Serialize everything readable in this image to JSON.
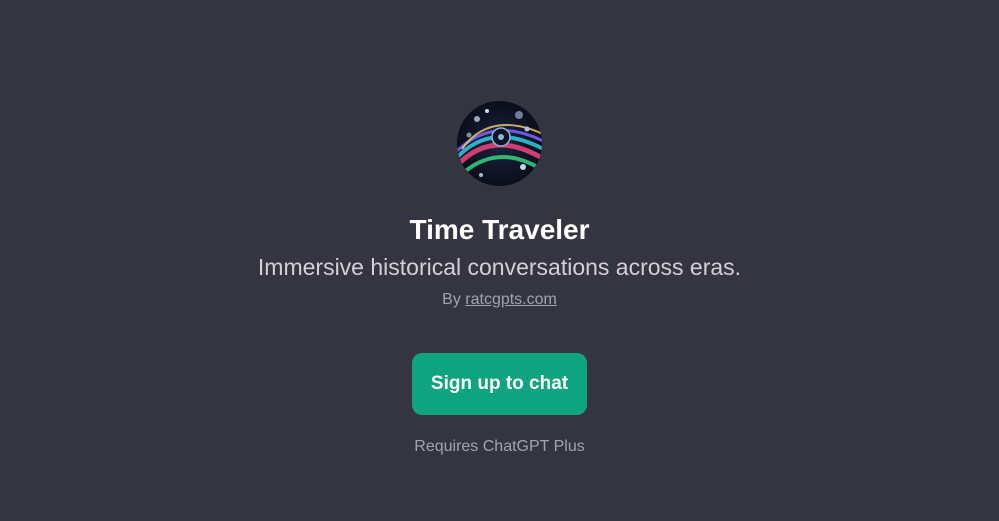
{
  "gpt": {
    "title": "Time Traveler",
    "description": "Immersive historical conversations across eras.",
    "byline_prefix": "By",
    "author": "ratcgpts.com",
    "avatar_icon": "swirling-time-vortex-avatar"
  },
  "cta": {
    "label": "Sign up to chat"
  },
  "requirement": "Requires ChatGPT Plus",
  "colors": {
    "background": "#343541",
    "accent": "#10a37f",
    "title": "#ffffff",
    "subtitle": "#d1d1d6",
    "muted": "#a3a3ad"
  }
}
